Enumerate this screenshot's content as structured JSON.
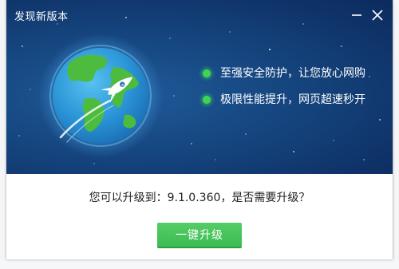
{
  "dialog": {
    "title": "发现新版本",
    "minimize_icon": "minimize-icon",
    "close_icon": "close-icon"
  },
  "banner": {
    "illustration": "earth-rocket-icon",
    "features": [
      {
        "text": "至强安全防护，让您放心网购"
      },
      {
        "text": "极限性能提升，网页超速秒开"
      }
    ]
  },
  "prompt": {
    "question": "您可以升级到：9.1.0.360，是否需要升级？"
  },
  "actions": {
    "upgrade_label": "一键升级"
  },
  "colors": {
    "banner": "#164781",
    "accent_green": "#43c259",
    "feature_dot": "#3fd454"
  }
}
